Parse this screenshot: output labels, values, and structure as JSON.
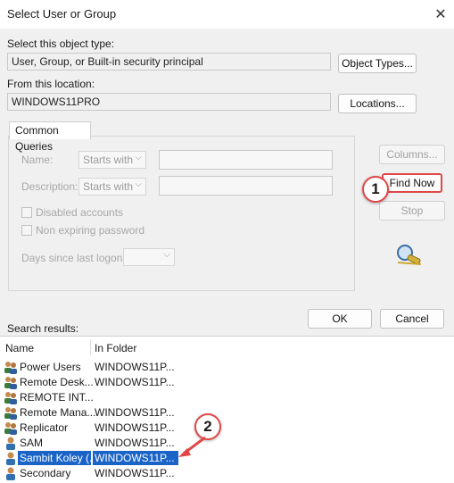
{
  "window": {
    "title": "Select User or Group"
  },
  "object_type": {
    "label": "Select this object type:",
    "value": "User, Group, or Built-in security principal",
    "button": "Object Types..."
  },
  "location": {
    "label": "From this location:",
    "value": "WINDOWS11PRO",
    "button": "Locations..."
  },
  "queries": {
    "tab": "Common Queries",
    "name_label": "Name:",
    "name_mode": "Starts with",
    "description_label": "Description:",
    "description_mode": "Starts with",
    "disabled_accounts": "Disabled accounts",
    "non_expiring": "Non expiring password",
    "days_label": "Days since last logon:"
  },
  "side_buttons": {
    "columns": "Columns...",
    "find_now": "Find Now",
    "stop": "Stop"
  },
  "dialog_buttons": {
    "ok": "OK",
    "cancel": "Cancel"
  },
  "results": {
    "label": "Search results:",
    "columns": [
      "Name",
      "In Folder"
    ],
    "rows": [
      {
        "name": "Power Users",
        "folder": "WINDOWS11P...",
        "type": "group"
      },
      {
        "name": "Remote Desk...",
        "folder": "WINDOWS11P...",
        "type": "group"
      },
      {
        "name": "REMOTE INT...",
        "folder": "",
        "type": "group"
      },
      {
        "name": "Remote Mana...",
        "folder": "WINDOWS11P...",
        "type": "group"
      },
      {
        "name": "Replicator",
        "folder": "WINDOWS11P...",
        "type": "group"
      },
      {
        "name": "SAM",
        "folder": "WINDOWS11P...",
        "type": "user"
      },
      {
        "name": "Sambit Koley (...",
        "folder": "WINDOWS11P...",
        "type": "user",
        "selected": true
      },
      {
        "name": "Secondary",
        "folder": "WINDOWS11P...",
        "type": "user"
      }
    ]
  },
  "callouts": {
    "one": "1",
    "two": "2"
  },
  "colors": {
    "highlight": "#e04848",
    "selection": "#1a64c8"
  }
}
